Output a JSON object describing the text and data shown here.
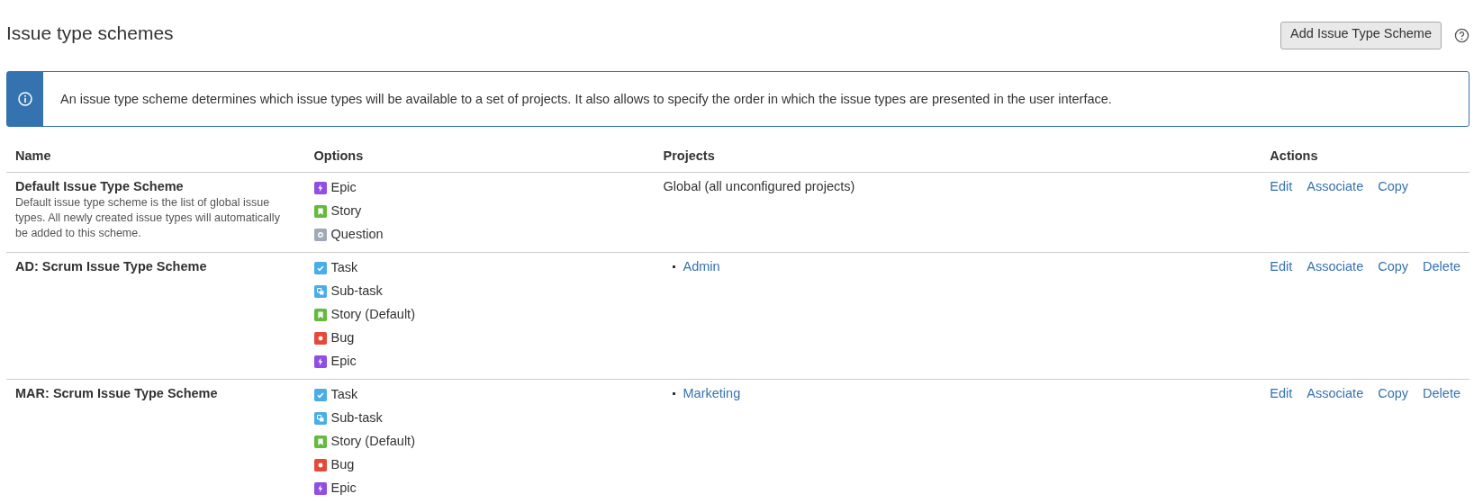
{
  "page": {
    "title": "Issue type schemes",
    "add_button": "Add Issue Type Scheme"
  },
  "info_message": "An issue type scheme determines which issue types will be available to a set of projects. It also allows to specify the order in which the issue types are presented in the user interface.",
  "table": {
    "columns": [
      "Name",
      "Options",
      "Projects",
      "Actions"
    ],
    "rows": [
      {
        "name": "Default Issue Type Scheme",
        "description": "Default issue type scheme is the list of global issue types. All newly created issue types will automatically be added to this scheme.",
        "options": [
          {
            "kind": "epic",
            "label": "Epic"
          },
          {
            "kind": "story",
            "label": "Story"
          },
          {
            "kind": "question",
            "label": "Question"
          }
        ],
        "projects_text": "Global (all unconfigured projects)",
        "actions": [
          "Edit",
          "Associate",
          "Copy"
        ]
      },
      {
        "name": "AD: Scrum Issue Type Scheme",
        "options": [
          {
            "kind": "task",
            "label": "Task"
          },
          {
            "kind": "subtask",
            "label": "Sub-task"
          },
          {
            "kind": "story",
            "label": "Story (Default)"
          },
          {
            "kind": "bug",
            "label": "Bug"
          },
          {
            "kind": "epic",
            "label": "Epic"
          }
        ],
        "projects": [
          "Admin"
        ],
        "actions": [
          "Edit",
          "Associate",
          "Copy",
          "Delete"
        ]
      },
      {
        "name": "MAR: Scrum Issue Type Scheme",
        "options": [
          {
            "kind": "task",
            "label": "Task"
          },
          {
            "kind": "subtask",
            "label": "Sub-task"
          },
          {
            "kind": "story",
            "label": "Story (Default)"
          },
          {
            "kind": "bug",
            "label": "Bug"
          },
          {
            "kind": "epic",
            "label": "Epic"
          }
        ],
        "projects": [
          "Marketing"
        ],
        "actions": [
          "Edit",
          "Associate",
          "Copy",
          "Delete"
        ]
      }
    ]
  }
}
